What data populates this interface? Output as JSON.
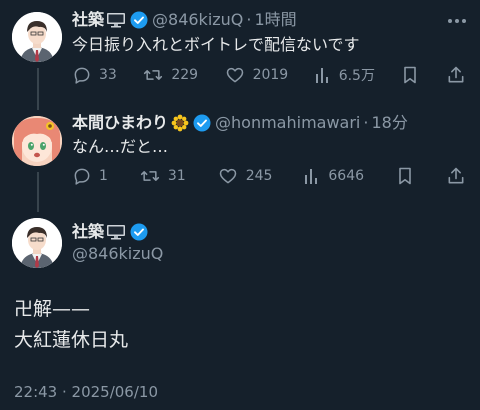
{
  "colors": {
    "background": "#15202b",
    "text": "#e7e9ea",
    "muted": "#8b98a5",
    "verified": "#1d9bf0"
  },
  "tweet1": {
    "display_name": "社築",
    "name_emoji": "monitor-emoji",
    "handle": "@846kizuQ",
    "separator": "·",
    "time": "1時間",
    "text": "今日振り入れとボイトレで配信ないです",
    "replies": "33",
    "retweets": "229",
    "likes": "2019",
    "views": "6.5万"
  },
  "tweet2": {
    "display_name": "本間ひまわり",
    "name_emoji": "sunflower-emoji",
    "handle": "@honmahimawari",
    "separator": "·",
    "time": "18分",
    "text": "なん…だと…",
    "replies": "1",
    "retweets": "31",
    "likes": "245",
    "views": "6646"
  },
  "focus_tweet": {
    "display_name": "社築",
    "name_emoji": "monitor-emoji",
    "handle": "@846kizuQ",
    "line1": "卍解——",
    "line2": "大紅蓮休日丸",
    "timestamp": "22:43 · 2025/06/10"
  }
}
